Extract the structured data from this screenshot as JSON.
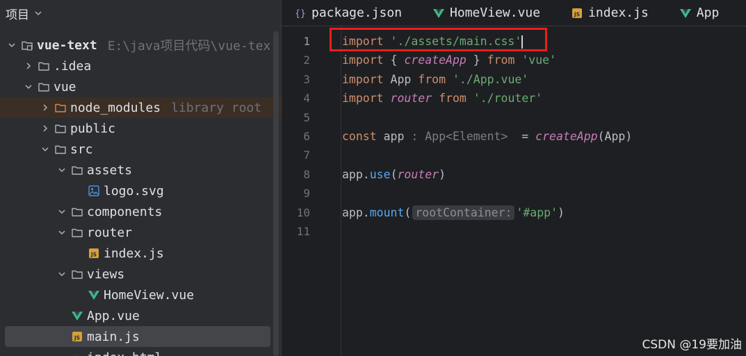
{
  "panel": {
    "title": "项目"
  },
  "tree": [
    {
      "label": "vue-text",
      "hint": "E:\\java项目代码\\vue-tex",
      "bold": true,
      "depth": 0,
      "arrow": "down",
      "icon": "module-folder-icon"
    },
    {
      "label": ".idea",
      "depth": 1,
      "arrow": "right",
      "icon": "folder-icon"
    },
    {
      "label": "vue",
      "depth": 1,
      "arrow": "down",
      "icon": "folder-icon"
    },
    {
      "label": "node_modules",
      "hint": "library root",
      "depth": 2,
      "arrow": "right",
      "icon": "excluded-folder-icon",
      "excluded": true
    },
    {
      "label": "public",
      "depth": 2,
      "arrow": "right",
      "icon": "folder-icon"
    },
    {
      "label": "src",
      "depth": 2,
      "arrow": "down",
      "icon": "folder-icon"
    },
    {
      "label": "assets",
      "depth": 3,
      "arrow": "down",
      "icon": "folder-icon"
    },
    {
      "label": "logo.svg",
      "depth": 4,
      "arrow": "none",
      "icon": "image-file-icon"
    },
    {
      "label": "components",
      "depth": 3,
      "arrow": "down",
      "icon": "folder-icon"
    },
    {
      "label": "router",
      "depth": 3,
      "arrow": "down",
      "icon": "folder-icon"
    },
    {
      "label": "index.js",
      "depth": 4,
      "arrow": "none",
      "icon": "js-file-icon"
    },
    {
      "label": "views",
      "depth": 3,
      "arrow": "down",
      "icon": "folder-icon"
    },
    {
      "label": "HomeView.vue",
      "depth": 4,
      "arrow": "none",
      "icon": "vue-file-icon"
    },
    {
      "label": "App.vue",
      "depth": 3,
      "arrow": "none",
      "icon": "vue-file-icon"
    },
    {
      "label": "main.js",
      "depth": 3,
      "arrow": "none",
      "icon": "js-file-icon",
      "selected": true
    },
    {
      "label": "index.html",
      "depth": 3,
      "arrow": "none",
      "icon": "html-file-icon"
    }
  ],
  "tabs": [
    {
      "label": "package.json",
      "icon": "json-file-icon"
    },
    {
      "label": "HomeView.vue",
      "icon": "vue-file-icon"
    },
    {
      "label": "index.js",
      "icon": "js-file-icon"
    },
    {
      "label": "App",
      "icon": "vue-file-icon"
    }
  ],
  "editor": {
    "current_line": 1,
    "lines": [
      [
        [
          "kw",
          "import"
        ],
        [
          "plain",
          " "
        ],
        [
          "str",
          "'./assets/main.css'"
        ],
        [
          "caret",
          ""
        ]
      ],
      [
        [
          "kw",
          "import"
        ],
        [
          "plain",
          " { "
        ],
        [
          "fn",
          "createApp"
        ],
        [
          "plain",
          " } "
        ],
        [
          "kw",
          "from"
        ],
        [
          "plain",
          " "
        ],
        [
          "str",
          "'vue'"
        ]
      ],
      [
        [
          "kw",
          "import"
        ],
        [
          "plain",
          " App "
        ],
        [
          "kw",
          "from"
        ],
        [
          "plain",
          " "
        ],
        [
          "str",
          "'./App.vue'"
        ]
      ],
      [
        [
          "kw",
          "import"
        ],
        [
          "plain",
          " "
        ],
        [
          "var",
          "router"
        ],
        [
          "plain",
          " "
        ],
        [
          "kw",
          "from"
        ],
        [
          "plain",
          " "
        ],
        [
          "str",
          "'./router'"
        ]
      ],
      [],
      [
        [
          "kw",
          "const"
        ],
        [
          "plain",
          " app "
        ],
        [
          "inlay",
          ": App<Element>"
        ],
        [
          "plain",
          "  = "
        ],
        [
          "fn",
          "createApp"
        ],
        [
          "plain",
          "(App)"
        ]
      ],
      [],
      [
        [
          "plain",
          "app."
        ],
        [
          "method",
          "use"
        ],
        [
          "plain",
          "("
        ],
        [
          "var",
          "router"
        ],
        [
          "plain",
          ")"
        ]
      ],
      [],
      [
        [
          "plain",
          "app."
        ],
        [
          "method",
          "mount"
        ],
        [
          "plain",
          "("
        ],
        [
          "inlaybox",
          "rootContainer:"
        ],
        [
          "str",
          "'#app'"
        ],
        [
          "plain",
          ")"
        ]
      ],
      []
    ]
  },
  "watermark": "CSDN @19要加油",
  "colors": {
    "highlight": "#e8201c",
    "excluded_row": "#3b2e25",
    "selected_row": "#43454a"
  }
}
